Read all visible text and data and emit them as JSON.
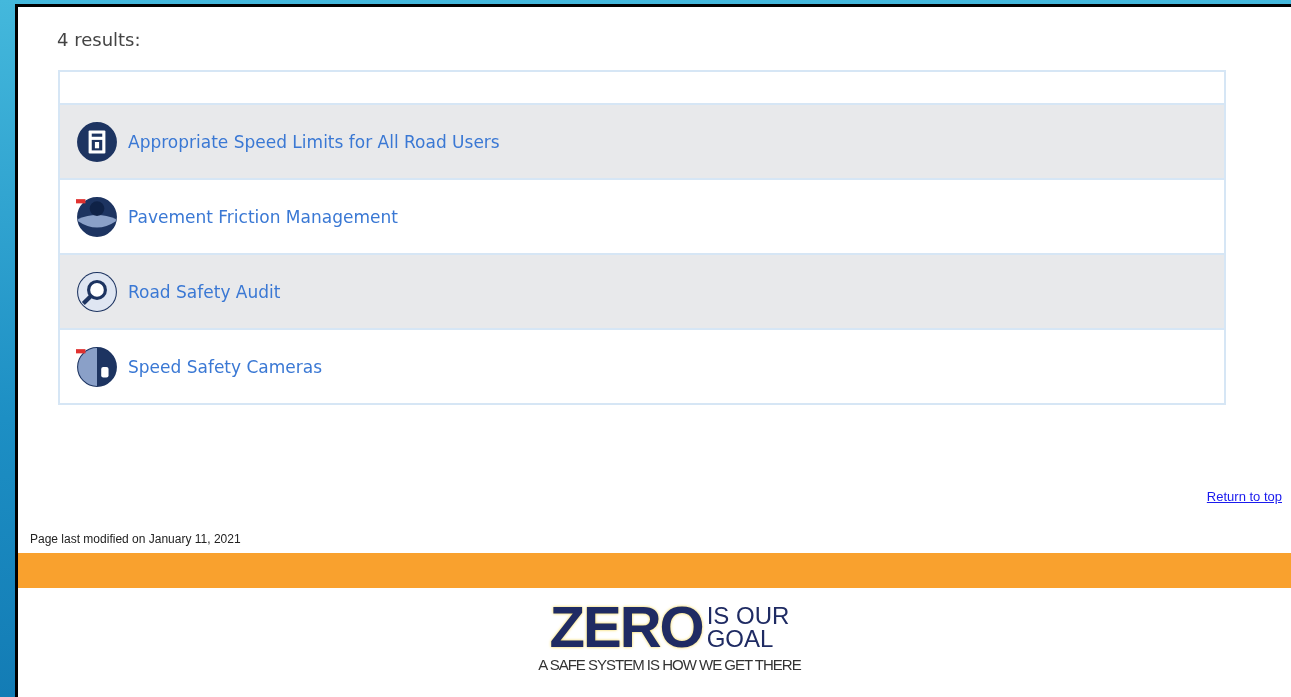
{
  "results_count": "4 results:",
  "results": [
    {
      "title": "Appropriate Speed Limits for All Road Users",
      "kind": "sign",
      "flagged": false
    },
    {
      "title": "Pavement Friction Management",
      "kind": "pavement",
      "flagged": true
    },
    {
      "title": "Road Safety Audit",
      "kind": "magnifier",
      "flagged": false
    },
    {
      "title": "Speed Safety Cameras",
      "kind": "camera",
      "flagged": true
    }
  ],
  "return_link": "Return to top",
  "last_modified": "Page last modified on January 11, 2021",
  "logo": {
    "word": "ZERO",
    "line_1": "IS OUR",
    "line_2": "GOAL",
    "tagline": "A SAFE SYSTEM IS HOW WE GET THERE"
  }
}
